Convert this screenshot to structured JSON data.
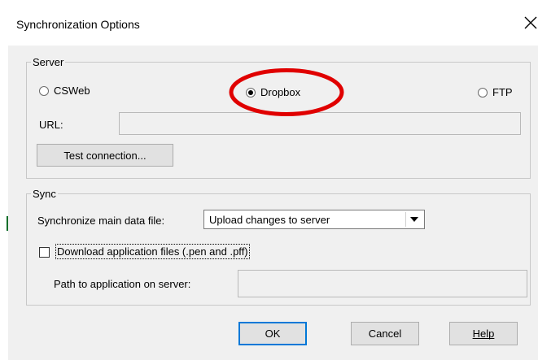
{
  "dialog": {
    "title": "Synchronization Options"
  },
  "server": {
    "group_label": "Server",
    "options": [
      {
        "label": "CSWeb",
        "selected": false
      },
      {
        "label": "Dropbox",
        "selected": true
      },
      {
        "label": "FTP",
        "selected": false
      }
    ],
    "url_label": "URL:",
    "url_value": "",
    "test_button": "Test connection..."
  },
  "sync": {
    "group_label": "Sync",
    "main_file_label": "Synchronize main data file:",
    "main_file_value": "Upload changes to server",
    "download_label": "Download application files (.pen and .pff)",
    "download_checked": false,
    "path_label": "Path to application on server:",
    "path_value": ""
  },
  "buttons": {
    "ok": "OK",
    "cancel": "Cancel",
    "help": "Help"
  },
  "colors": {
    "dialog_bg": "#f0f0f0",
    "annotation": "#e00000"
  }
}
